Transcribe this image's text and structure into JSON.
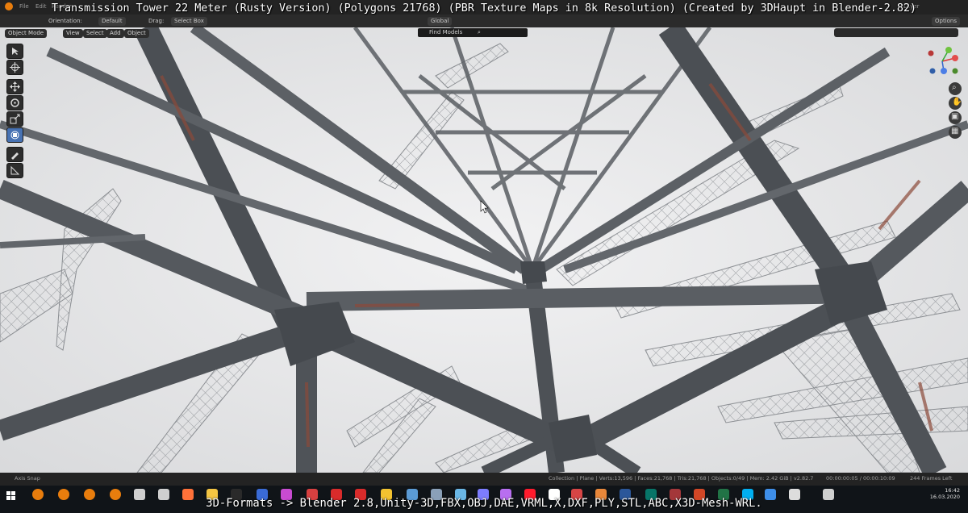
{
  "overlay": {
    "title": "Transmission Tower 22 Meter (Rusty Version) (Polygons 21768) (PBR Texture Maps in 8k Resolution) (Created by 3DHaupt in Blender-2.82)",
    "formats": "3D-Formats -> Blender 2.8,Unity-3D,FBX,OBJ,DAE,VRML,X,DXF,PLY,STL,ABC,X3D-Mesh-WRL."
  },
  "menubar": {
    "items": [
      "File",
      "Edit",
      "Render"
    ],
    "right_label": "Layer"
  },
  "header": {
    "orientation_label": "Orientation:",
    "orientation_value": "Default",
    "drag_label": "Drag:",
    "drag_value": "Select Box",
    "transform_space": "Global",
    "options_label": "Options",
    "mode": "Object Mode",
    "view_menu": "View",
    "select_menu": "Select",
    "add_menu": "Add",
    "object_menu": "Object",
    "search_placeholder": "Find Models"
  },
  "statusbar": {
    "left_hint": "Axis Snap",
    "stats": "Collection | Plane | Verts:13,596 | Faces:21,768 | Tris:21,768 | Objects:0/49 | Mem: 2.42 GiB | v2.82.7",
    "timecode": "00:00:00:05 / 00:00:10:09",
    "frames_left": "244 Frames Left"
  },
  "taskbar": {
    "time": "16:42",
    "date": "16.03.2020",
    "icons": [
      {
        "name": "start-icon",
        "color": "#ffffff"
      },
      {
        "name": "blender-icon",
        "color": "#e87d0d"
      },
      {
        "name": "blender-icon",
        "color": "#e87d0d"
      },
      {
        "name": "blender-icon",
        "color": "#e87d0d"
      },
      {
        "name": "blender-icon",
        "color": "#e87d0d"
      },
      {
        "name": "unity-icon",
        "color": "#cfcfcf"
      },
      {
        "name": "unity-icon",
        "color": "#cfcfcf"
      },
      {
        "name": "firefox-icon",
        "color": "#ff7139"
      },
      {
        "name": "folder-icon",
        "color": "#f4c542"
      },
      {
        "name": "terminal-icon",
        "color": "#2a2a2a"
      },
      {
        "name": "save-icon",
        "color": "#3a6bd6"
      },
      {
        "name": "app-icon",
        "color": "#c84bd1"
      },
      {
        "name": "gear-icon",
        "color": "#d84040"
      },
      {
        "name": "pdf-icon",
        "color": "#d92b2b"
      },
      {
        "name": "pdf-icon",
        "color": "#d92b2b"
      },
      {
        "name": "x-icon",
        "color": "#f2c230"
      },
      {
        "name": "app-icon",
        "color": "#5b9bd5"
      },
      {
        "name": "app-icon",
        "color": "#8aa0b8"
      },
      {
        "name": "app-icon",
        "color": "#6ab7e6"
      },
      {
        "name": "app-icon",
        "color": "#7d7dff"
      },
      {
        "name": "map-pin-icon",
        "color": "#b86ef0"
      },
      {
        "name": "opera-icon",
        "color": "#ff1b2d"
      },
      {
        "name": "app-icon",
        "color": "#ffffff"
      },
      {
        "name": "app-icon",
        "color": "#d64545"
      },
      {
        "name": "app-icon",
        "color": "#e8873a"
      },
      {
        "name": "word-icon",
        "color": "#2b579a"
      },
      {
        "name": "publisher-icon",
        "color": "#077568"
      },
      {
        "name": "access-icon",
        "color": "#a4373a"
      },
      {
        "name": "powerpoint-icon",
        "color": "#d24726"
      },
      {
        "name": "excel-icon",
        "color": "#217346"
      },
      {
        "name": "skype-icon",
        "color": "#00aff0"
      },
      {
        "name": "app-icon",
        "color": "#3e8ee8"
      },
      {
        "name": "unity-icon",
        "color": "#dddddd"
      },
      {
        "name": "app-icon",
        "color": "#cfcfcf"
      }
    ]
  }
}
